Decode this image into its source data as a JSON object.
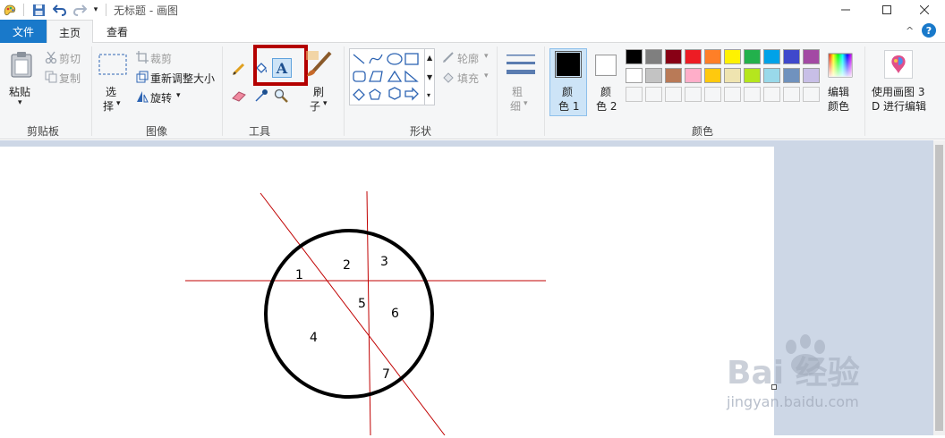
{
  "window": {
    "title": "无标题 - 画图",
    "controls": [
      "minimize",
      "maximize",
      "close"
    ]
  },
  "quick_access": {
    "icons": [
      "paint-app-icon",
      "save-icon",
      "undo-icon",
      "redo-icon",
      "customize-dropdown-icon"
    ]
  },
  "tabs": [
    {
      "label": "文件",
      "selected": false
    },
    {
      "label": "主页",
      "selected": true
    },
    {
      "label": "查看",
      "selected": false
    }
  ],
  "ribbon": {
    "clipboard": {
      "group_label": "剪贴板",
      "paste_label": "粘贴",
      "cut_label": "剪切",
      "copy_label": "复制"
    },
    "image": {
      "group_label": "图像",
      "select_label_1": "选",
      "select_label_2": "择",
      "crop_label": "裁剪",
      "resize_label": "重新调整大小",
      "rotate_label": "旋转"
    },
    "tools": {
      "group_label": "工具",
      "selected_tool": "text-tool"
    },
    "brushes": {
      "label_1": "刷",
      "label_2": "子"
    },
    "shapes": {
      "group_label": "形状",
      "outline_label": "轮廓",
      "fill_label": "填充"
    },
    "size": {
      "label_1": "粗",
      "label_2": "细"
    },
    "colors": {
      "group_label": "颜色",
      "color1_label_1": "颜",
      "color1_label_2": "色 1",
      "color2_label_1": "颜",
      "color2_label_2": "色 2",
      "color1_value": "#000000",
      "color2_value": "#ffffff",
      "edit_label_1": "编辑",
      "edit_label_2": "颜色",
      "palette_row1": [
        "#000000",
        "#7f7f7f",
        "#880015",
        "#ed1c24",
        "#ff7f27",
        "#fff200",
        "#22b14c",
        "#00a2e8",
        "#3f48cc",
        "#a349a4"
      ],
      "palette_row2": [
        "#ffffff",
        "#c3c3c3",
        "#b97a57",
        "#ffaec9",
        "#ffc90e",
        "#efe4b0",
        "#b5e61d",
        "#99d9ea",
        "#7092be",
        "#c8bfe7"
      ]
    },
    "paint3d": {
      "label_1": "使用画图 3",
      "label_2": "D 进行编辑"
    }
  },
  "drawing": {
    "region_labels": [
      "1",
      "2",
      "3",
      "4",
      "5",
      "6",
      "7"
    ],
    "circle_color": "#000000",
    "line_color": "#c00000"
  },
  "highlight_color": "#b40000",
  "watermark": {
    "brand": "Bai 经验",
    "url": "jingyan.baidu.com"
  }
}
